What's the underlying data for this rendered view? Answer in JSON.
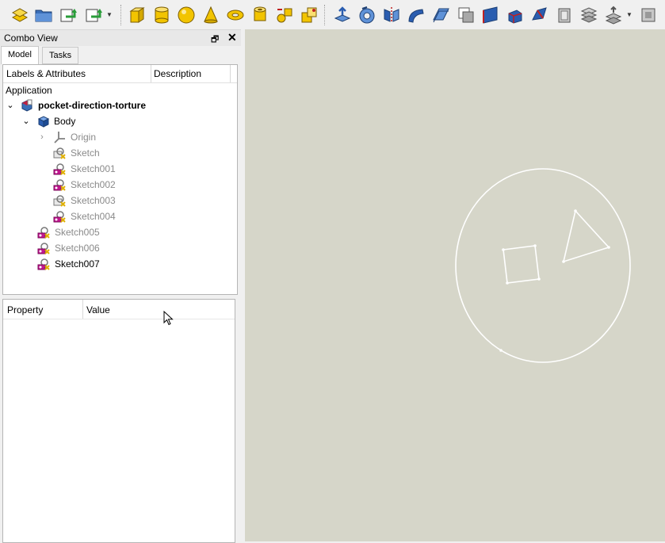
{
  "toolbar": {
    "icons": [
      "part-design-workbench-icon",
      "open-file-icon",
      "undo-icon",
      "redo-icon",
      "cube-icon",
      "cylinder-icon",
      "sphere-icon",
      "cone-icon",
      "torus-icon",
      "tube-icon",
      "shape-builder-icon",
      "boolean-icon",
      "extrude-icon",
      "revolve-icon",
      "mirror-icon",
      "fillet-icon",
      "offset-icon",
      "section-icon",
      "ruled-surface-icon",
      "loft-icon",
      "sweep-icon",
      "shell-icon",
      "thickness-icon",
      "compound-icon",
      "projection-icon"
    ]
  },
  "combo": {
    "title": "Combo View",
    "tabs": [
      "Model",
      "Tasks"
    ],
    "active_tab": "Model"
  },
  "tree": {
    "columns": [
      "Labels & Attributes",
      "Description"
    ],
    "section": "Application",
    "items": [
      {
        "label": "pocket-direction-torture",
        "icon": "document-part-icon",
        "expanded": true
      },
      {
        "label": "Body",
        "icon": "body-icon",
        "expanded": true
      },
      {
        "label": "Origin",
        "icon": "origin-icon",
        "collapsed": true
      },
      {
        "label": "Sketch",
        "icon": "sketch-icon"
      },
      {
        "label": "Sketch001",
        "icon": "sketch-error-icon"
      },
      {
        "label": "Sketch002",
        "icon": "sketch-error-icon"
      },
      {
        "label": "Sketch003",
        "icon": "sketch-icon"
      },
      {
        "label": "Sketch004",
        "icon": "sketch-error-icon"
      },
      {
        "label": "Sketch005",
        "icon": "sketch-error-icon"
      },
      {
        "label": "Sketch006",
        "icon": "sketch-error-icon"
      },
      {
        "label": "Sketch007",
        "icon": "sketch-error-icon"
      }
    ]
  },
  "properties": {
    "columns": [
      "Property",
      "Value"
    ]
  },
  "colors": {
    "viewport_bg": "#d6d6c9",
    "sketch_line": "#ffffff",
    "accent_blue": "#2a5db0",
    "icon_yellow": "#f2c400",
    "error_magenta": "#c0178f"
  }
}
